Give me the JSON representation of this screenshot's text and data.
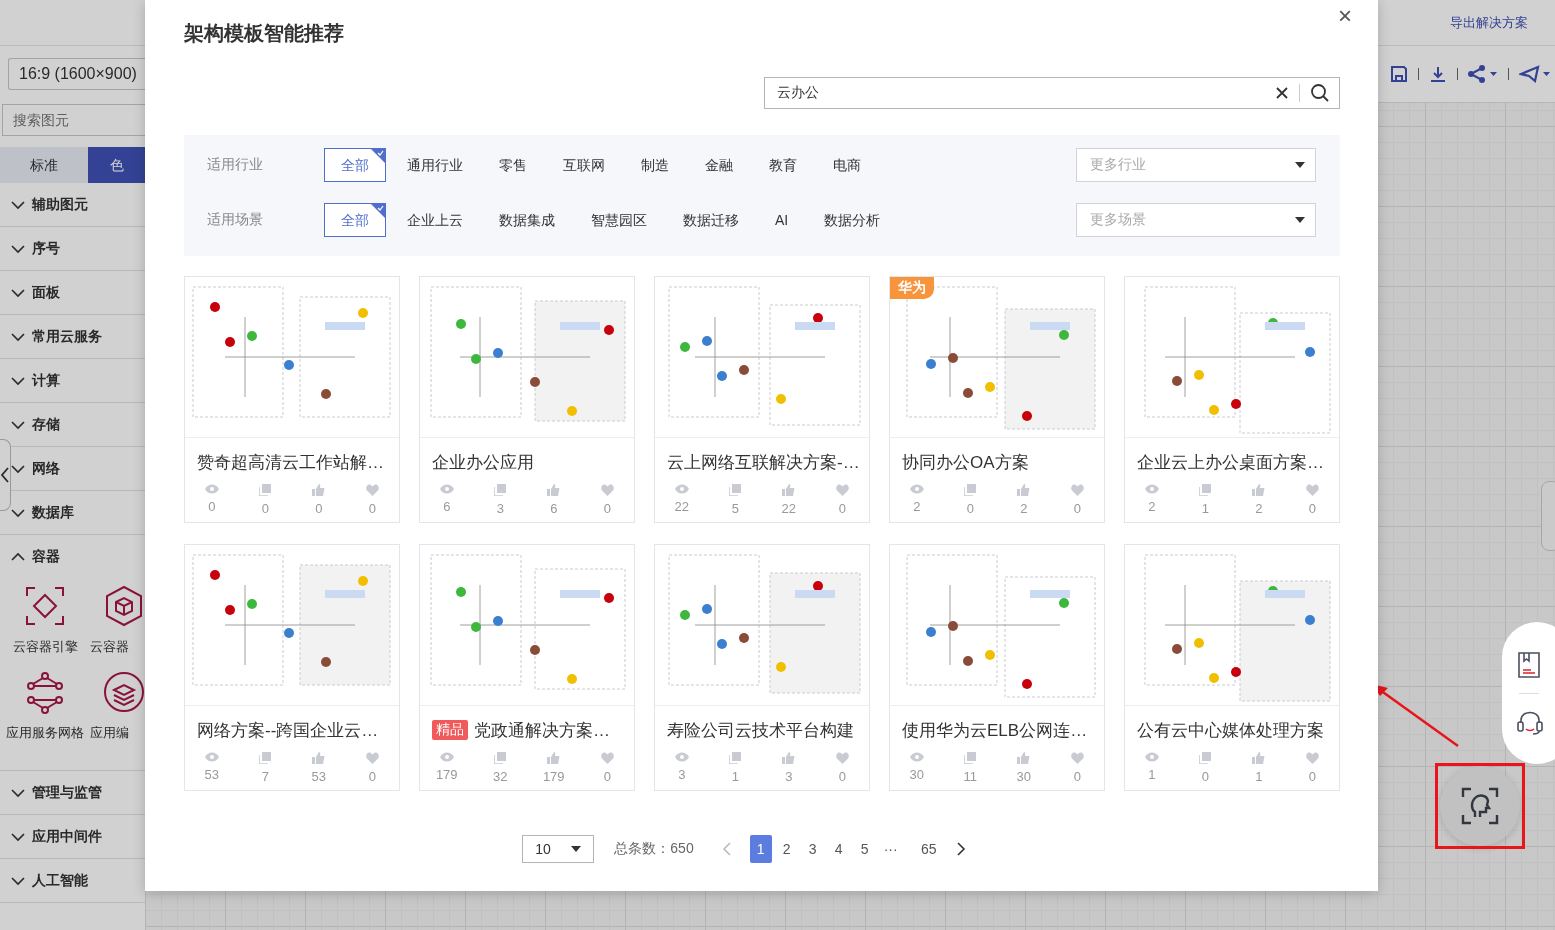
{
  "app_header": {
    "export_link": "导出解决方案"
  },
  "sidebar": {
    "canvas_size": "16:9 (1600×900)",
    "search": {
      "placeholder": "搜索图元"
    },
    "tabs": [
      {
        "label": "标准",
        "selected": false
      },
      {
        "label": "色",
        "selected": true
      }
    ],
    "sections": [
      {
        "label": "辅助图元",
        "expanded": false
      },
      {
        "label": "序号",
        "expanded": false
      },
      {
        "label": "面板",
        "expanded": false
      },
      {
        "label": "常用云服务",
        "expanded": false
      },
      {
        "label": "计算",
        "expanded": false
      },
      {
        "label": "存储",
        "expanded": false
      },
      {
        "label": "网络",
        "expanded": false
      },
      {
        "label": "数据库",
        "expanded": false
      },
      {
        "label": "容器",
        "expanded": true,
        "items": [
          "云容器引擎",
          "云容器",
          "应用服务网格",
          "应用编"
        ]
      },
      {
        "label": "管理与监管",
        "expanded": false
      },
      {
        "label": "应用中间件",
        "expanded": false
      },
      {
        "label": "人工智能",
        "expanded": false
      }
    ]
  },
  "dialog": {
    "title": "架构模板智能推荐",
    "close": "×",
    "search": {
      "value": "云办公"
    },
    "filters": [
      {
        "label": "适用行业",
        "options": [
          {
            "label": "全部",
            "selected": true
          },
          {
            "label": "通用行业",
            "selected": false
          },
          {
            "label": "零售",
            "selected": false
          },
          {
            "label": "互联网",
            "selected": false
          },
          {
            "label": "制造",
            "selected": false
          },
          {
            "label": "金融",
            "selected": false
          },
          {
            "label": "教育",
            "selected": false
          },
          {
            "label": "电商",
            "selected": false
          }
        ],
        "more": {
          "placeholder": "更多行业"
        }
      },
      {
        "label": "适用场景",
        "options": [
          {
            "label": "全部",
            "selected": true
          },
          {
            "label": "企业上云",
            "selected": false
          },
          {
            "label": "数据集成",
            "selected": false
          },
          {
            "label": "智慧园区",
            "selected": false
          },
          {
            "label": "数据迁移",
            "selected": false
          },
          {
            "label": "AI",
            "selected": false
          },
          {
            "label": "数据分析",
            "selected": false
          }
        ],
        "more": {
          "placeholder": "更多场景"
        }
      }
    ],
    "templates": [
      {
        "title": "赞奇超高清云工作站解…",
        "views": "0",
        "copies": "0",
        "likes": "0",
        "favorites": "0"
      },
      {
        "title": "企业办公应用",
        "views": "6",
        "copies": "3",
        "likes": "6",
        "favorites": "0"
      },
      {
        "title": "云上网络互联解决方案-…",
        "views": "22",
        "copies": "5",
        "likes": "22",
        "favorites": "0"
      },
      {
        "title": "协同办公OA方案",
        "badge": "华为",
        "views": "2",
        "copies": "0",
        "likes": "2",
        "favorites": "0"
      },
      {
        "title": "企业云上办公桌面方案…",
        "views": "2",
        "copies": "1",
        "likes": "2",
        "favorites": "0"
      },
      {
        "title": "网络方案--跨国企业云…",
        "views": "53",
        "copies": "7",
        "likes": "53",
        "favorites": "0"
      },
      {
        "title": "党政通解决方案…",
        "tag": "精品",
        "views": "179",
        "copies": "32",
        "likes": "179",
        "favorites": "0"
      },
      {
        "title": "寿险公司云技术平台构建",
        "views": "3",
        "copies": "1",
        "likes": "3",
        "favorites": "0"
      },
      {
        "title": "使用华为云ELB公网连…",
        "views": "30",
        "copies": "11",
        "likes": "30",
        "favorites": "0"
      },
      {
        "title": "公有云中心媒体处理方案",
        "views": "1",
        "copies": "0",
        "likes": "1",
        "favorites": "0"
      }
    ],
    "pagination": {
      "page_size": "10",
      "total": "总条数：650",
      "prev_disabled": true,
      "pages": [
        {
          "label": "1",
          "selected": true
        },
        {
          "label": "2",
          "selected": false
        },
        {
          "label": "3",
          "selected": false
        },
        {
          "label": "4",
          "selected": false
        },
        {
          "label": "5",
          "selected": false
        },
        {
          "label": "···",
          "selected": false
        },
        {
          "label": "65",
          "selected": false
        }
      ]
    }
  }
}
